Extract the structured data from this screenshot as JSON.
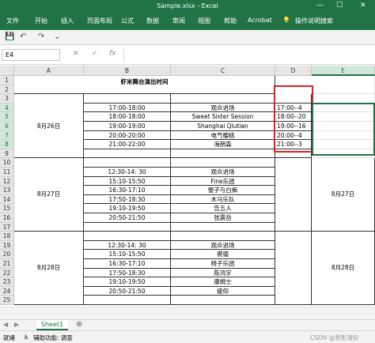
{
  "window": {
    "title": "Sample.xlsx  -  Excel"
  },
  "ribbon": {
    "tabs": [
      "文件",
      "开始",
      "插入",
      "页面布局",
      "公式",
      "数据",
      "审阅",
      "视图",
      "帮助",
      "Acrobat"
    ],
    "search": "操作说明搜索"
  },
  "qat": {
    "save": "💾",
    "undo": "↶",
    "redo": "↷",
    "more": "⌄"
  },
  "formula_bar": {
    "name_box": "E4",
    "cancel": "✕",
    "confirm": "✓",
    "fx": "fx",
    "value": ""
  },
  "columns": [
    "A",
    "B",
    "C",
    "D",
    "E"
  ],
  "rows": [
    "1",
    "2",
    "3",
    "4",
    "5",
    "6",
    "7",
    "8",
    "9",
    "10",
    "11",
    "12",
    "13",
    "14",
    "15",
    "16",
    "17",
    "18",
    "19",
    "20",
    "21",
    "22",
    "23",
    "24",
    "25"
  ],
  "sheet": {
    "header_title": "虾米舞台演出时间",
    "day1": {
      "date": "8月26日",
      "times": [
        "17:00-18:00",
        "18:00-18:00",
        "19:00-19:00",
        "20:00-20:00",
        "21:00-22:00"
      ],
      "acts": [
        "观众进场",
        "Sweet Sister Session",
        "Shanghai Qiutian",
        "电气樱桃",
        "海朋森"
      ],
      "d": [
        "17:00--4",
        "18:00--20",
        "19:00--16",
        "20:00--4",
        "21:00--3"
      ]
    },
    "day2": {
      "date": "8月27日",
      "times": [
        "12:30-14:  30",
        "15:10-15:50",
        "16:30-17:10",
        "17:50-18:30",
        "19:10-19:50",
        "20:50-21:50"
      ],
      "acts": [
        "观众进场",
        "Fine乐团",
        "傻子与白痴",
        "木马乐队",
        "告五人",
        "张震岳"
      ],
      "e_date": "8月27日"
    },
    "day3": {
      "date": "8月28日",
      "times": [
        "12:30-14:  30",
        "15:10-15:50",
        "16:30-17:10",
        "17:50-18:30",
        "19:10-19:50",
        "20:50-21:50"
      ],
      "acts": [
        "观众进场",
        "裘德",
        "椅子乐团",
        "陈鸿宇",
        "康姆士",
        "瘦仰"
      ],
      "e_date": "8月28日"
    }
  },
  "tabs": {
    "sheet1": "Sheet1",
    "add": "⊕"
  },
  "status": {
    "ready": "就绪",
    "accessibility": "辅助功能: 调查",
    "watermark": "CSDN @景影澄阴"
  }
}
